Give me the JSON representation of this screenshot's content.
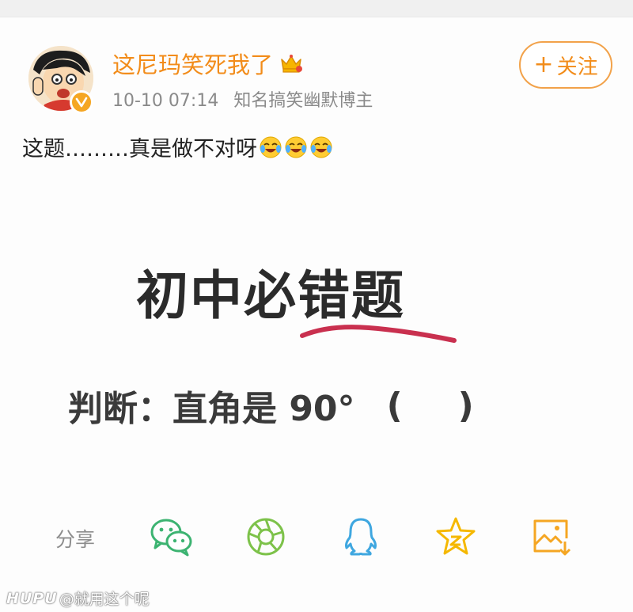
{
  "post": {
    "username": "这尼玛笑死我了",
    "date": "10-10 07:14",
    "user_title": "知名搞笑幽默博主",
    "follow_label": "关注",
    "follow_plus": "+",
    "text": "这题………真是做不对呀",
    "emoji_icons": [
      "laugh-cry-icon",
      "laugh-cry-icon",
      "laugh-cry-icon"
    ]
  },
  "image": {
    "title": "初中必错题",
    "question": "判断：直角是 90°",
    "paren_open": "(",
    "paren_close": ")"
  },
  "share": {
    "label": "分享",
    "icons": [
      "wechat-icon",
      "moments-icon",
      "qq-icon",
      "qzone-icon",
      "save-image-icon"
    ]
  },
  "watermark": {
    "brand": "HUPU",
    "handle": "@就用这个呢"
  },
  "colors": {
    "accent": "#f28c1a",
    "wechat": "#3cb371",
    "moments": "#7dc24a",
    "qq": "#3fa7e0",
    "qzone": "#f5b800",
    "save": "#f5a623",
    "underline": "#c9304f"
  }
}
